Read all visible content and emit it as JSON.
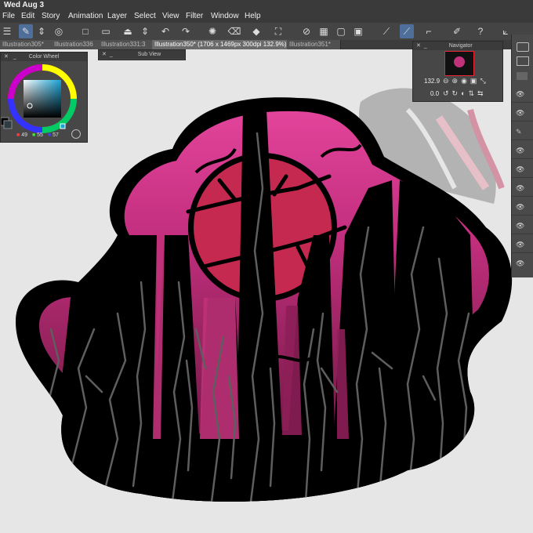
{
  "status": {
    "date": "Wed Aug 3"
  },
  "menu": [
    "File",
    "Edit",
    "Story",
    "Animation",
    "Layer",
    "Select",
    "View",
    "Filter",
    "Window",
    "Help"
  ],
  "tabs": [
    "Illustration305*",
    "Illustration336",
    "Illustration331:3",
    "Illustration350* (1706 x 1469px 300dpi 132.9%)",
    "Illustration351*"
  ],
  "color_wheel": {
    "title": "Color Wheel",
    "r": "49",
    "g": "55",
    "b": "57"
  },
  "sub_view": {
    "title": "Sub View"
  },
  "navigator": {
    "title": "Navigator",
    "zoom": "132.9",
    "rotation": "0.0"
  },
  "colors": {
    "pink_top": "#e0448f",
    "magenta": "#c0327a",
    "deep": "#7a1a48",
    "moon": "#c5294f",
    "ink": "#000000",
    "branch": "#5e5e5e"
  }
}
